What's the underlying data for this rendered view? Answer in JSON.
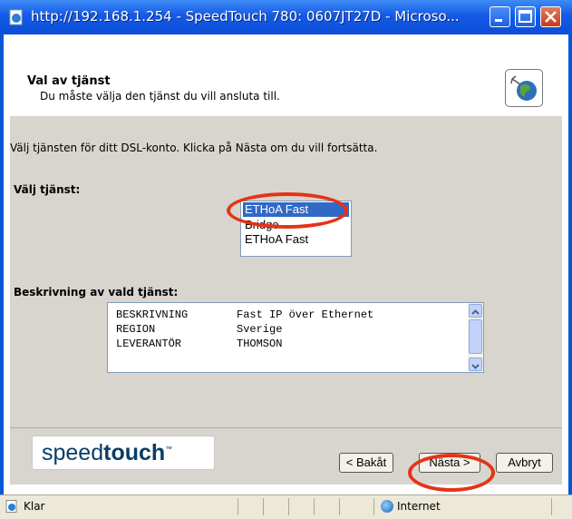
{
  "window": {
    "title": "http://192.168.1.254 - SpeedTouch 780:  0607JT27D - Microso..."
  },
  "header": {
    "title": "Val av tjänst",
    "subtitle": "Du måste välja den tjänst du vill ansluta till."
  },
  "main": {
    "intro": "Välj tjänsten för ditt DSL-konto. Klicka på Nästa om du vill fortsätta.",
    "service_label": "Välj tjänst:",
    "service_options": [
      "ETHoA Fast",
      "Bridge",
      "ETHoA Fast"
    ],
    "selected_index": 0,
    "description_label": "Beskrivning av vald tjänst:",
    "description_rows": [
      {
        "key": "BESKRIVNING",
        "value": "Fast IP över Ethernet"
      },
      {
        "key": "REGION",
        "value": "Sverige"
      },
      {
        "key": "LEVERANTÖR",
        "value": "THOMSON"
      }
    ]
  },
  "footer": {
    "logo_light": "speed",
    "logo_bold": "touch",
    "logo_tm": "™",
    "back_label": "< Bakåt",
    "next_label": "Nästa >",
    "cancel_label": "Avbryt"
  },
  "statusbar": {
    "status": "Klar",
    "zone": "Internet"
  },
  "colors": {
    "titlebar": "#0b4fd8",
    "selection": "#316ac5",
    "highlight_ring": "#e53316",
    "panel": "#d7d5ce"
  },
  "icons": [
    "ie-page-icon",
    "minimize-icon",
    "maximize-icon",
    "close-icon",
    "globe-wizard-icon",
    "scroll-up-icon",
    "scroll-down-icon",
    "internet-zone-icon"
  ]
}
